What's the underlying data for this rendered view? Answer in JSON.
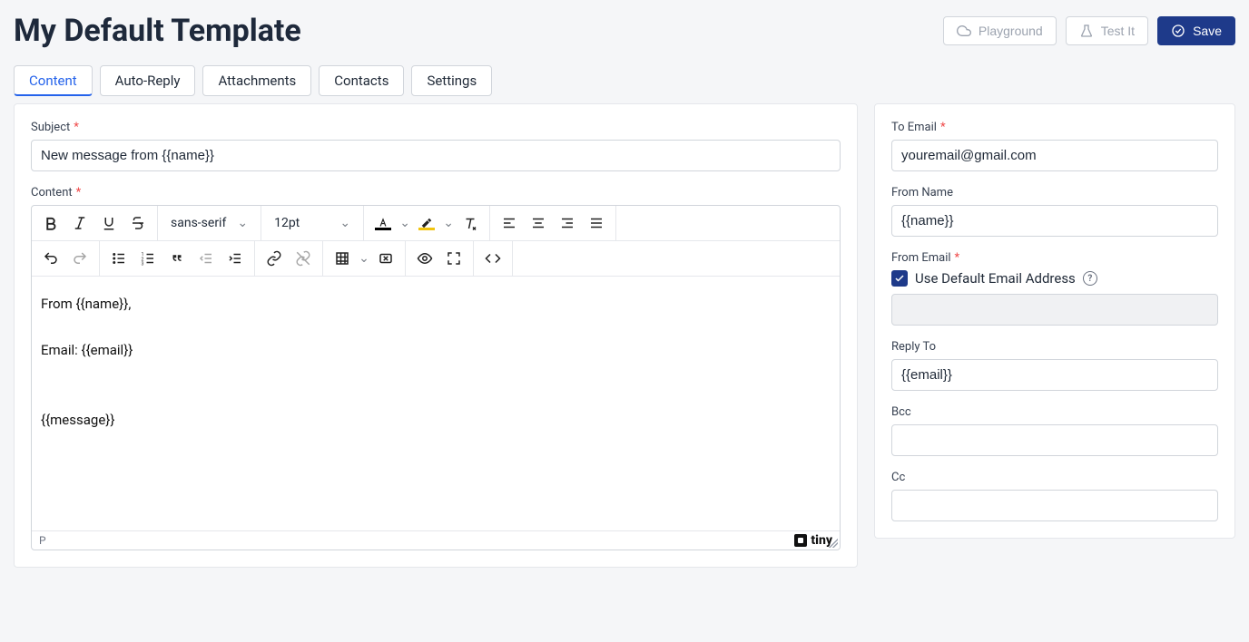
{
  "header": {
    "title": "My Default Template",
    "playground": "Playground",
    "testit": "Test It",
    "save": "Save"
  },
  "tabs": {
    "content": "Content",
    "autoreply": "Auto-Reply",
    "attachments": "Attachments",
    "contacts": "Contacts",
    "settings": "Settings"
  },
  "main": {
    "subject_label": "Subject",
    "subject_value": "New message from {{name}}",
    "content_label": "Content",
    "font_family": "sans-serif",
    "font_size": "12pt",
    "body": "From {{name}},\n\nEmail: {{email}}\n\n\n{{message}}",
    "status_path": "P",
    "logo": "tiny"
  },
  "side": {
    "to_email_label": "To Email",
    "to_email_value": "youremail@gmail.com",
    "from_name_label": "From Name",
    "from_name_value": "{{name}}",
    "from_email_label": "From Email",
    "use_default_label": "Use Default Email Address",
    "from_email_value": "",
    "reply_to_label": "Reply To",
    "reply_to_value": "{{email}}",
    "bcc_label": "Bcc",
    "bcc_value": "",
    "cc_label": "Cc",
    "cc_value": ""
  }
}
